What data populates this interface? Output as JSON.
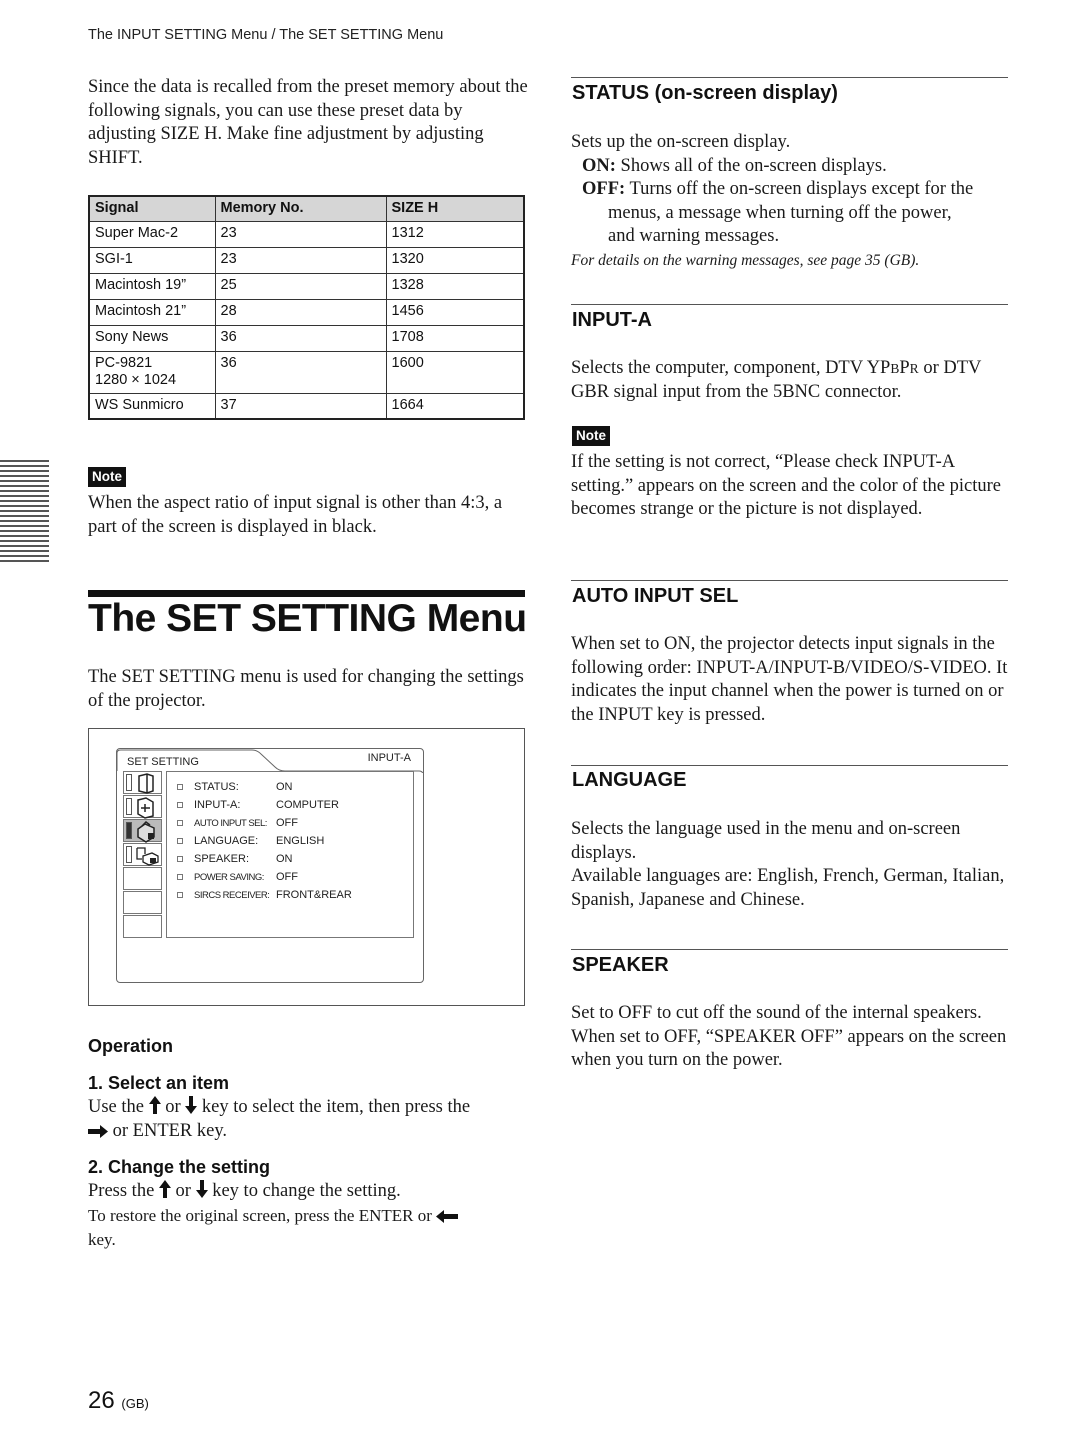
{
  "header": {
    "running_title": "The INPUT SETTING Menu / The SET SETTING Menu"
  },
  "intro": {
    "text": "Since the data is recalled from the preset memory about the following signals, you can use these preset data by adjusting SIZE H. Make fine adjustment by adjusting SHIFT."
  },
  "signal_table": {
    "headers": [
      "Signal",
      "Memory No.",
      "SIZE H"
    ],
    "rows": [
      {
        "signal": "Super Mac-2",
        "signal2": "",
        "memory": "23",
        "size_h": "1312"
      },
      {
        "signal": "SGI-1",
        "signal2": "",
        "memory": "23",
        "size_h": "1320"
      },
      {
        "signal": "Macintosh 19”",
        "signal2": "",
        "memory": "25",
        "size_h": "1328"
      },
      {
        "signal": "Macintosh 21”",
        "signal2": "",
        "memory": "28",
        "size_h": "1456"
      },
      {
        "signal": "Sony News",
        "signal2": "",
        "memory": "36",
        "size_h": "1708"
      },
      {
        "signal": "PC-9821",
        "signal2": "1280 × 1024",
        "memory": "36",
        "size_h": "1600"
      },
      {
        "signal": "WS Sunmicro",
        "signal2": "",
        "memory": "37",
        "size_h": "1664"
      }
    ]
  },
  "note_label": "Note",
  "note1": {
    "text": "When the aspect ratio of input signal is other than 4:3, a part of the screen is displayed in black."
  },
  "section": {
    "title": "The SET SETTING Menu",
    "intro": "The SET SETTING menu is used for changing the settings of the projector."
  },
  "osd": {
    "title": "SET SETTING",
    "input": "INPUT-A",
    "icons": [
      "input-setting-icon",
      "picture-ctrl-icon",
      "set-setting-icon",
      "menu-setting-icon",
      "",
      "",
      ""
    ],
    "active_icon_index": 2,
    "items": [
      {
        "label": "STATUS:",
        "value": "ON",
        "narrow": false
      },
      {
        "label": "INPUT-A:",
        "value": "COMPUTER",
        "narrow": false
      },
      {
        "label": "AUTO INPUT SEL:",
        "value": "OFF",
        "narrow": true
      },
      {
        "label": "LANGUAGE:",
        "value": "ENGLISH",
        "narrow": false
      },
      {
        "label": "SPEAKER:",
        "value": "ON",
        "narrow": false
      },
      {
        "label": "POWER SAVING:",
        "value": "OFF",
        "narrow": true
      },
      {
        "label": "SIRCS RECEIVER:",
        "value": "FRONT&REAR",
        "narrow": true
      }
    ]
  },
  "operation": {
    "title": "Operation",
    "step1": {
      "title": "1. Select an item",
      "text_a": "Use the",
      "text_b": "or",
      "text_c": "key to select the item, then press the",
      "text_d": "or ENTER key."
    },
    "step2": {
      "title": "2. Change the setting",
      "text_a": "Press the",
      "text_b": "or",
      "text_c": "key to change the setting.",
      "restore_a": "To restore the original screen, press the ENTER or",
      "restore_b": "key."
    }
  },
  "status": {
    "heading": "STATUS (on-screen display)",
    "intro": "Sets up the on-screen display.",
    "on_label": "ON:",
    "on_text": "Shows all of the on-screen displays.",
    "off_label": "OFF:",
    "off_text1": "Turns off the on-screen displays except for the",
    "off_text2": "menus, a message when turning off the power,",
    "off_text3": "and warning messages.",
    "ref": "For details on the warning messages, see page 35 (GB)."
  },
  "input_a": {
    "heading": "INPUT-A",
    "text_a": "Selects the computer, component, DTV YP",
    "sub_b": "B",
    "text_p": "P",
    "sub_r": "R",
    "text_b": " or DTV GBR signal input from the 5BNC connector.",
    "note_text": "If the setting is not correct, “Please check INPUT-A setting.” appears on the screen and the color of the picture becomes strange or the picture is not displayed."
  },
  "auto_input_sel": {
    "heading": "AUTO INPUT SEL",
    "text": "When set to ON, the projector detects input signals in the following order: INPUT-A/INPUT-B/VIDEO/S-VIDEO. It indicates the input channel when the power is turned on or the INPUT key is pressed."
  },
  "language": {
    "heading": "LANGUAGE",
    "text1": "Selects the language used in the menu and on-screen displays.",
    "text2": "Available languages are: English, French, German, Italian, Spanish, Japanese and Chinese."
  },
  "speaker": {
    "heading": "SPEAKER",
    "text": "Set to OFF to cut off the sound of the internal speakers. When set to OFF, “SPEAKER OFF” appears on the screen when you turn on the power."
  },
  "page": {
    "number": "26",
    "suffix": "(GB)"
  }
}
